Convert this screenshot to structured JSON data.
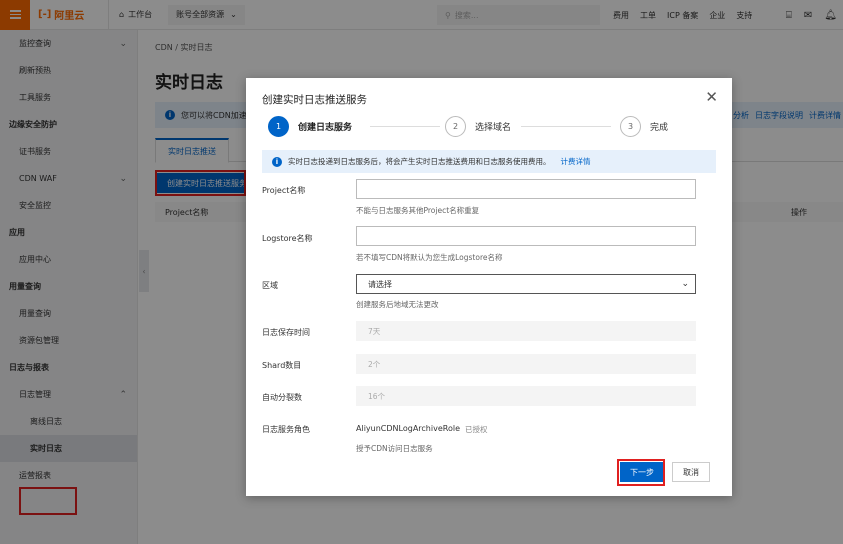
{
  "topbar": {
    "logo_text": "阿里云",
    "workbench": "工作台",
    "account_scope": "账号全部资源",
    "search_placeholder": "搜索...",
    "menu": [
      "费用",
      "工单",
      "ICP 备案",
      "企业",
      "支持"
    ]
  },
  "sidebar": {
    "items": [
      {
        "label": "监控查询",
        "type": "item",
        "chevron": "down"
      },
      {
        "label": "刷新预热",
        "type": "item"
      },
      {
        "label": "工具服务",
        "type": "item"
      },
      {
        "label": "边缘安全防护",
        "type": "head"
      },
      {
        "label": "证书服务",
        "type": "item"
      },
      {
        "label": "CDN WAF",
        "type": "item",
        "chevron": "down"
      },
      {
        "label": "安全监控",
        "type": "item"
      },
      {
        "label": "应用",
        "type": "head"
      },
      {
        "label": "应用中心",
        "type": "item"
      },
      {
        "label": "用量查询",
        "type": "head"
      },
      {
        "label": "用量查询",
        "type": "item"
      },
      {
        "label": "资源包管理",
        "type": "item"
      },
      {
        "label": "日志与报表",
        "type": "head"
      },
      {
        "label": "日志管理",
        "type": "item",
        "chevron": "up"
      },
      {
        "label": "离线日志",
        "type": "sub"
      },
      {
        "label": "实时日志",
        "type": "sub",
        "active": true
      },
      {
        "label": "运营报表",
        "type": "item"
      }
    ]
  },
  "main": {
    "breadcrumb": "CDN  /  实时日志",
    "title": "实时日志",
    "info_text": "您可以将CDN加速",
    "info_links": [
      "分析",
      "日志字段说明",
      "计费详情"
    ],
    "tab": "实时日志推送",
    "create_button": "创建实时日志推送服务",
    "col_project": "Project名称",
    "col_action": "操作"
  },
  "modal": {
    "title": "创建实时日志推送服务",
    "steps": [
      {
        "num": "1",
        "label": "创建日志服务"
      },
      {
        "num": "2",
        "label": "选择域名"
      },
      {
        "num": "3",
        "label": "完成"
      }
    ],
    "notice": "实时日志投递到日志服务后，将会产生实时日志推送费用和日志服务使用费用。",
    "notice_link": "计费详情",
    "fields": {
      "project_label": "Project名称",
      "project_help": "不能与日志服务其他Project名称重复",
      "logstore_label": "Logstore名称",
      "logstore_help": "若不填写CDN将默认为您生成Logstore名称",
      "region_label": "区域",
      "region_value": "请选择",
      "region_help": "创建服务后地域无法更改",
      "retention_label": "日志保存时间",
      "retention_value": "7天",
      "shard_label": "Shard数目",
      "shard_value": "2个",
      "autosplit_label": "自动分裂数",
      "autosplit_value": "16个",
      "role_label": "日志服务角色",
      "role_value": "AliyunCDNLogArchiveRole",
      "role_status": "已授权",
      "role_help": "授予CDN访问日志服务"
    },
    "next_button": "下一步",
    "cancel_button": "取消"
  },
  "colors": {
    "brand_orange": "#ff6a00",
    "primary_blue": "#0064c8",
    "highlight_red": "#e02020"
  }
}
